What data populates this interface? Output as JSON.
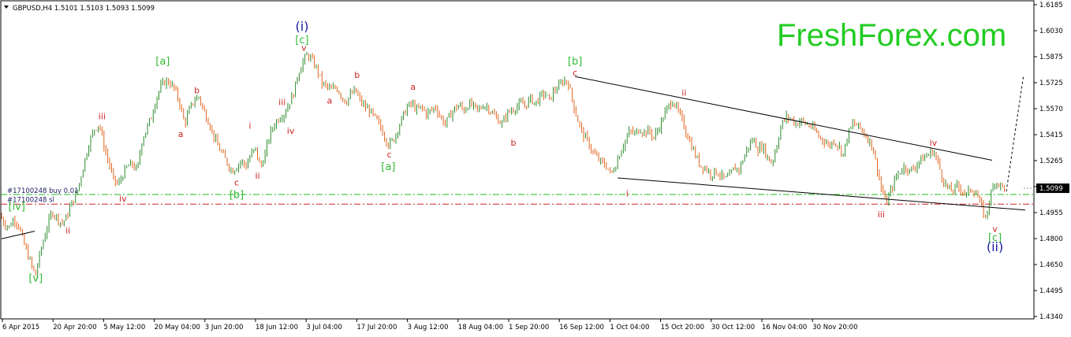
{
  "header": {
    "symbol_line": "GBPUSD,H4  1.5101 1.5103 1.5093 1.5099"
  },
  "brand": {
    "text": "FreshForex.com",
    "color": "#22cc22"
  },
  "colors": {
    "bull": "#2e8b2e",
    "bear": "#e0651e",
    "wave_red": "#cc2222",
    "wave_green": "#33bb33",
    "wave_blue": "#1a1aaa",
    "buy_line": "#22bb22",
    "sl_line": "#cc2222",
    "price_box_bg": "#000000"
  },
  "orders": {
    "buy_label": "#17100248 buy 0.01",
    "sl_label": "#17100248 sl",
    "buy_price": 1.5062,
    "sl_price": 1.5005
  },
  "current_price": {
    "value": 1.5099,
    "label": "1.5099"
  },
  "chart_data": {
    "type": "candlestick",
    "symbol": "GBPUSD",
    "timeframe": "H4",
    "ohlc_last": {
      "open": 1.5101,
      "high": 1.5103,
      "low": 1.5093,
      "close": 1.5099
    },
    "ylim": [
      1.434,
      1.6185
    ],
    "y_ticks": [
      "1.6185",
      "1.6030",
      "1.5875",
      "1.5725",
      "1.5570",
      "1.5415",
      "1.5265",
      "1.5110",
      "1.4955",
      "1.4800",
      "1.4650",
      "1.4495",
      "1.4340"
    ],
    "x_ticks": [
      "6 Apr 2015",
      "20 Apr 20:00",
      "5 May 12:00",
      "20 May 04:00",
      "3 Jun 20:00",
      "18 Jun 12:00",
      "3 Jul 04:00",
      "17 Jul 20:00",
      "3 Aug 12:00",
      "18 Aug 04:00",
      "1 Sep 20:00",
      "16 Sep 12:00",
      "1 Oct 04:00",
      "15 Oct 20:00",
      "30 Oct 12:00",
      "16 Nov 04:00",
      "30 Nov 20:00"
    ],
    "price_path": [
      [
        0,
        1.494
      ],
      [
        0.5,
        1.489
      ],
      [
        1,
        1.487
      ],
      [
        1.5,
        1.492
      ],
      [
        2,
        1.488
      ],
      [
        2.5,
        1.478
      ],
      [
        3,
        1.47
      ],
      [
        3.5,
        1.462
      ],
      [
        3.8,
        1.4585
      ],
      [
        4.2,
        1.47
      ],
      [
        4.8,
        1.483
      ],
      [
        5.5,
        1.496
      ],
      [
        6,
        1.493
      ],
      [
        6.5,
        1.489
      ],
      [
        7,
        1.492
      ],
      [
        7.5,
        1.5
      ],
      [
        8,
        1.505
      ],
      [
        8.5,
        1.515
      ],
      [
        9,
        1.527
      ],
      [
        9.5,
        1.538
      ],
      [
        10,
        1.545
      ],
      [
        10.5,
        1.548
      ],
      [
        11,
        1.535
      ],
      [
        11.5,
        1.525
      ],
      [
        12,
        1.515
      ],
      [
        12.5,
        1.512
      ],
      [
        13,
        1.518
      ],
      [
        13.5,
        1.523
      ],
      [
        14,
        1.524
      ],
      [
        14.5,
        1.52
      ],
      [
        15,
        1.538
      ],
      [
        15.5,
        1.545
      ],
      [
        16,
        1.552
      ],
      [
        16.5,
        1.563
      ],
      [
        17,
        1.57
      ],
      [
        17.5,
        1.5735
      ],
      [
        18,
        1.572
      ],
      [
        18.5,
        1.568
      ],
      [
        19,
        1.56
      ],
      [
        19.5,
        1.548
      ],
      [
        20,
        1.556
      ],
      [
        20.5,
        1.562
      ],
      [
        21,
        1.564
      ],
      [
        21.5,
        1.556
      ],
      [
        22,
        1.55
      ],
      [
        22.5,
        1.542
      ],
      [
        23,
        1.535
      ],
      [
        23.5,
        1.53
      ],
      [
        24,
        1.525
      ],
      [
        24.5,
        1.52
      ],
      [
        25,
        1.523
      ],
      [
        25.5,
        1.526
      ],
      [
        26,
        1.523
      ],
      [
        26.5,
        1.53
      ],
      [
        27,
        1.533
      ],
      [
        27.5,
        1.522
      ],
      [
        28,
        1.53
      ],
      [
        28.5,
        1.542
      ],
      [
        29,
        1.548
      ],
      [
        29.5,
        1.552
      ],
      [
        30,
        1.554
      ],
      [
        30.5,
        1.56
      ],
      [
        31,
        1.566
      ],
      [
        31.5,
        1.578
      ],
      [
        32,
        1.585
      ],
      [
        32.5,
        1.589
      ],
      [
        33,
        1.585
      ],
      [
        33.5,
        1.58
      ],
      [
        34,
        1.572
      ],
      [
        34.5,
        1.57
      ],
      [
        35,
        1.568
      ],
      [
        35.5,
        1.57
      ],
      [
        36,
        1.565
      ],
      [
        36.5,
        1.561
      ],
      [
        37,
        1.565
      ],
      [
        37.5,
        1.568
      ],
      [
        38,
        1.562
      ],
      [
        38.5,
        1.558
      ],
      [
        39,
        1.556
      ],
      [
        39.5,
        1.552
      ],
      [
        40,
        1.548
      ],
      [
        40.5,
        1.542
      ],
      [
        41,
        1.536
      ],
      [
        41.5,
        1.538
      ],
      [
        42,
        1.545
      ],
      [
        42.5,
        1.552
      ],
      [
        43,
        1.558
      ],
      [
        43.5,
        1.56
      ],
      [
        44,
        1.556
      ],
      [
        44.5,
        1.558
      ],
      [
        45,
        1.554
      ],
      [
        45.5,
        1.556
      ],
      [
        46,
        1.558
      ],
      [
        46.5,
        1.552
      ],
      [
        47,
        1.548
      ],
      [
        47.5,
        1.553
      ],
      [
        48,
        1.557
      ],
      [
        48.5,
        1.559
      ],
      [
        49,
        1.556
      ],
      [
        49.5,
        1.56
      ],
      [
        50,
        1.558
      ],
      [
        50.5,
        1.556
      ],
      [
        51,
        1.559
      ],
      [
        51.5,
        1.558
      ],
      [
        52,
        1.554
      ],
      [
        52.5,
        1.551
      ],
      [
        53,
        1.548
      ],
      [
        53.5,
        1.554
      ],
      [
        54,
        1.556
      ],
      [
        54.5,
        1.558
      ],
      [
        55,
        1.56
      ],
      [
        55.5,
        1.559
      ],
      [
        56,
        1.563
      ],
      [
        56.5,
        1.56
      ],
      [
        57,
        1.564
      ],
      [
        57.5,
        1.566
      ],
      [
        58,
        1.562
      ],
      [
        58.5,
        1.568
      ],
      [
        59,
        1.57
      ],
      [
        59.5,
        1.574
      ],
      [
        60,
        1.572
      ],
      [
        60.5,
        1.56
      ],
      [
        61,
        1.55
      ],
      [
        61.5,
        1.542
      ],
      [
        62,
        1.538
      ],
      [
        62.5,
        1.532
      ],
      [
        63,
        1.528
      ],
      [
        63.5,
        1.525
      ],
      [
        64,
        1.523
      ],
      [
        64.5,
        1.518
      ],
      [
        65,
        1.524
      ],
      [
        65.5,
        1.532
      ],
      [
        66,
        1.538
      ],
      [
        66.5,
        1.544
      ],
      [
        67,
        1.542
      ],
      [
        67.5,
        1.545
      ],
      [
        68,
        1.543
      ],
      [
        68.5,
        1.544
      ],
      [
        69,
        1.54
      ],
      [
        69.5,
        1.545
      ],
      [
        70,
        1.552
      ],
      [
        70.5,
        1.558
      ],
      [
        71,
        1.562
      ],
      [
        71.5,
        1.556
      ],
      [
        72,
        1.55
      ],
      [
        72.5,
        1.542
      ],
      [
        73,
        1.535
      ],
      [
        73.5,
        1.528
      ],
      [
        74,
        1.523
      ],
      [
        74.5,
        1.522
      ],
      [
        75,
        1.518
      ],
      [
        75.5,
        1.52
      ],
      [
        76,
        1.518
      ],
      [
        76.5,
        1.515
      ],
      [
        77,
        1.517
      ],
      [
        77.5,
        1.522
      ],
      [
        78,
        1.521
      ],
      [
        78.5,
        1.528
      ],
      [
        79,
        1.535
      ],
      [
        79.5,
        1.539
      ],
      [
        80,
        1.533
      ],
      [
        80.5,
        1.535
      ],
      [
        81,
        1.528
      ],
      [
        81.5,
        1.525
      ],
      [
        82,
        1.536
      ],
      [
        82.5,
        1.548
      ],
      [
        83,
        1.552
      ],
      [
        83.5,
        1.551
      ],
      [
        84,
        1.548
      ],
      [
        84.5,
        1.55
      ],
      [
        85,
        1.548
      ],
      [
        85.5,
        1.547
      ],
      [
        86,
        1.544
      ],
      [
        86.5,
        1.54
      ],
      [
        87,
        1.538
      ],
      [
        87.5,
        1.535
      ],
      [
        88,
        1.538
      ],
      [
        88.5,
        1.535
      ],
      [
        89,
        1.53
      ],
      [
        89.5,
        1.542
      ],
      [
        90,
        1.548
      ],
      [
        90.5,
        1.547
      ],
      [
        91,
        1.544
      ],
      [
        91.5,
        1.54
      ],
      [
        92,
        1.536
      ],
      [
        92.5,
        1.524
      ],
      [
        93,
        1.51
      ],
      [
        93.5,
        1.501
      ],
      [
        94,
        1.508
      ],
      [
        94.5,
        1.516
      ],
      [
        95,
        1.52
      ],
      [
        95.5,
        1.523
      ],
      [
        96,
        1.52
      ],
      [
        96.5,
        1.522
      ],
      [
        97,
        1.526
      ],
      [
        97.5,
        1.528
      ],
      [
        98,
        1.53
      ],
      [
        98.5,
        1.532
      ],
      [
        99,
        1.525
      ],
      [
        99.5,
        1.515
      ],
      [
        100,
        1.51
      ],
      [
        100.5,
        1.508
      ],
      [
        101,
        1.511
      ],
      [
        101.5,
        1.509
      ],
      [
        102,
        1.506
      ],
      [
        102.5,
        1.51
      ],
      [
        103,
        1.507
      ],
      [
        103.5,
        1.5
      ],
      [
        104,
        1.492
      ],
      [
        104.5,
        1.505
      ],
      [
        105,
        1.514
      ],
      [
        105.5,
        1.512
      ],
      [
        106,
        1.5099
      ]
    ],
    "trendlines": [
      {
        "name": "upper",
        "p1": [
          60.5,
          1.576
        ],
        "p2": [
          104.5,
          1.5265
        ]
      },
      {
        "name": "lower",
        "p1": [
          65,
          1.516
        ],
        "p2": [
          108,
          1.497
        ]
      },
      {
        "name": "left-stub",
        "p1": [
          0,
          1.48
        ],
        "p2": [
          3.5,
          1.4845
        ]
      }
    ],
    "projection": {
      "p1": [
        106,
        1.508
      ],
      "p2": [
        107.8,
        1.576
      ]
    },
    "wave_labels": [
      {
        "text": "(i)",
        "color": "blue",
        "x": 31.7,
        "price": 1.605,
        "size": "big"
      },
      {
        "text": "[c]",
        "color": "green",
        "x": 31.7,
        "price": 1.5975
      },
      {
        "text": "v",
        "color": "red",
        "x": 31.9,
        "price": 1.593
      },
      {
        "text": "[a]",
        "color": "green",
        "x": 17,
        "price": 1.585
      },
      {
        "text": "iii",
        "color": "red",
        "x": 10.6,
        "price": 1.5525
      },
      {
        "text": "b",
        "color": "red",
        "x": 20.6,
        "price": 1.568
      },
      {
        "text": "a",
        "color": "red",
        "x": 18.9,
        "price": 1.542
      },
      {
        "text": "i",
        "color": "red",
        "x": 26.2,
        "price": 1.547
      },
      {
        "text": "iii",
        "color": "red",
        "x": 29.6,
        "price": 1.561
      },
      {
        "text": "iv",
        "color": "red",
        "x": 30.5,
        "price": 1.544
      },
      {
        "text": "b",
        "color": "red",
        "x": 37.5,
        "price": 1.577
      },
      {
        "text": "a",
        "color": "red",
        "x": 34.6,
        "price": 1.562
      },
      {
        "text": "c",
        "color": "red",
        "x": 24.8,
        "price": 1.5135
      },
      {
        "text": "ii",
        "color": "red",
        "x": 27,
        "price": 1.5175
      },
      {
        "text": "[b]",
        "color": "green",
        "x": 24.8,
        "price": 1.506
      },
      {
        "text": "iv",
        "color": "red",
        "x": 12.8,
        "price": 1.504
      },
      {
        "text": "ii",
        "color": "red",
        "x": 7,
        "price": 1.485
      },
      {
        "text": "[iv]",
        "color": "green",
        "x": 1.6,
        "price": 1.499
      },
      {
        "text": "[v]",
        "color": "green",
        "x": 3.6,
        "price": 1.4565
      },
      {
        "text": "a",
        "color": "red",
        "x": 43.4,
        "price": 1.57
      },
      {
        "text": "c",
        "color": "red",
        "x": 40.9,
        "price": 1.53
      },
      {
        "text": "[a]",
        "color": "green",
        "x": 40.8,
        "price": 1.5225
      },
      {
        "text": "b",
        "color": "red",
        "x": 54,
        "price": 1.537
      },
      {
        "text": "[b]",
        "color": "green",
        "x": 60.5,
        "price": 1.585
      },
      {
        "text": "c",
        "color": "red",
        "x": 60.5,
        "price": 1.5785
      },
      {
        "text": "i",
        "color": "red",
        "x": 66,
        "price": 1.507
      },
      {
        "text": "ii",
        "color": "red",
        "x": 72,
        "price": 1.5665
      },
      {
        "text": "iv",
        "color": "red",
        "x": 98.3,
        "price": 1.537
      },
      {
        "text": "iii",
        "color": "red",
        "x": 92.8,
        "price": 1.4945
      },
      {
        "text": "v",
        "color": "red",
        "x": 104.8,
        "price": 1.486
      },
      {
        "text": "[c]",
        "color": "green",
        "x": 104.8,
        "price": 1.4805
      },
      {
        "text": "(ii)",
        "color": "blue",
        "x": 104.8,
        "price": 1.4745,
        "size": "big"
      }
    ]
  }
}
